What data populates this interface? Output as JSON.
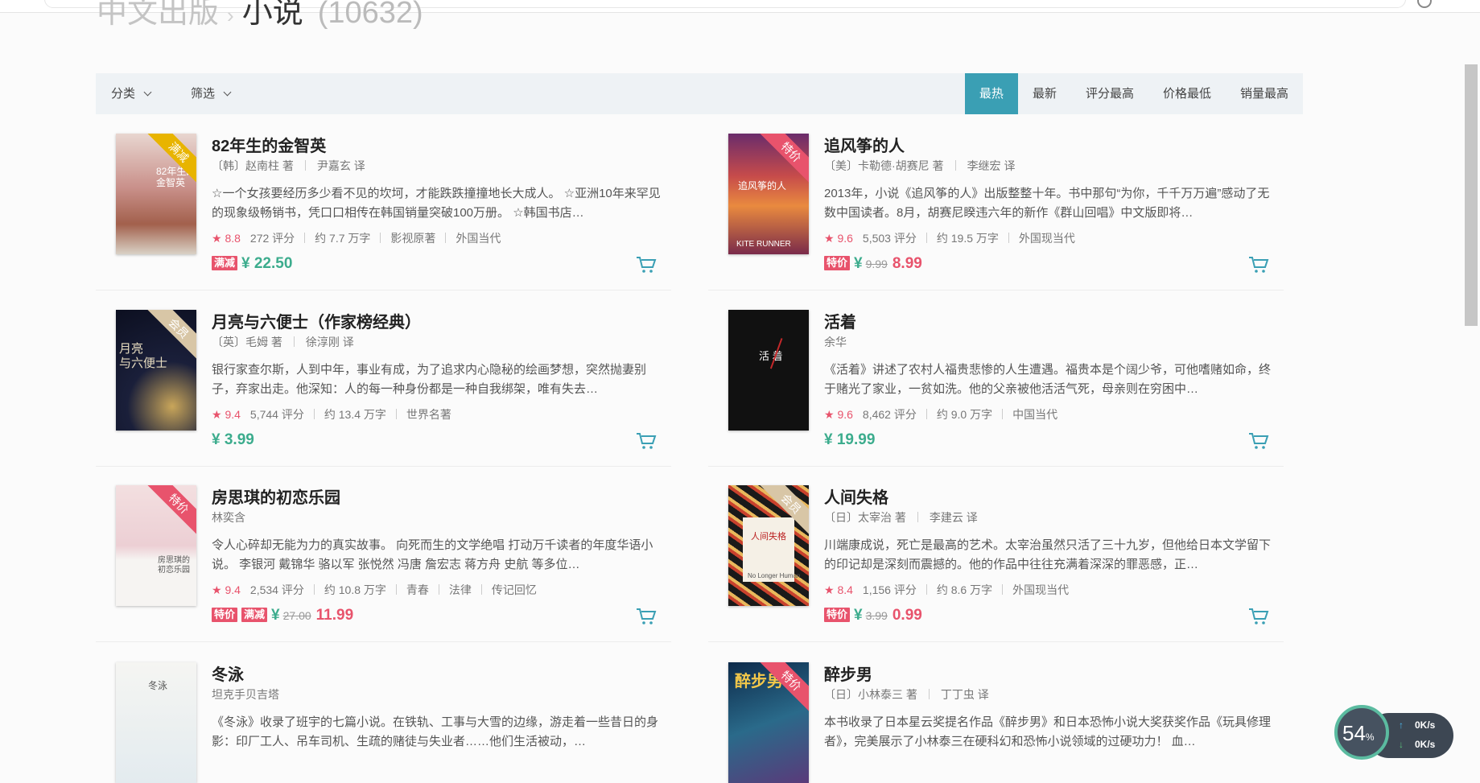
{
  "breadcrumb": {
    "category": "中文出版",
    "current": "小说",
    "count": "(10632)"
  },
  "filters": [
    {
      "label": "分类"
    },
    {
      "label": "筛选"
    }
  ],
  "sorts": [
    {
      "label": "最热",
      "active": true
    },
    {
      "label": "最新"
    },
    {
      "label": "评分最高"
    },
    {
      "label": "价格最低"
    },
    {
      "label": "销量最高"
    }
  ],
  "books": [
    {
      "title": "82年生的金智英",
      "authors": [
        "〔韩〕赵南柱 著",
        "尹嘉玄 译"
      ],
      "desc": "☆一个女孩要经历多少看不见的坎坷，才能跌跌撞撞地长大成人。 ☆亚洲10年来罕见的现象级畅销书，凭口口相传在韩国销量突破100万册。 ☆韩国书店…",
      "rating": "8.8",
      "reviews": "272 评分",
      "words": "约 7.7 万字",
      "tags": [
        "影视原著",
        "外国当代"
      ],
      "badges": [
        "满减"
      ],
      "price": "¥ 22.50",
      "ribbon": "满减",
      "cover_title": "82年生的\n金智英"
    },
    {
      "title": "追风筝的人",
      "authors": [
        "〔美〕卡勒德·胡赛尼 著",
        "李继宏 译"
      ],
      "desc": "2013年，小说《追风筝的人》出版整整十年。书中那句“为你，千千万万遍”感动了无数中国读者。8月，胡赛尼睽违六年的新作《群山回唱》中文版即将…",
      "rating": "9.6",
      "reviews": "5,503 评分",
      "words": "约 19.5 万字",
      "tags": [
        "外国现当代"
      ],
      "badges": [
        "特价"
      ],
      "old_price": "9.99",
      "new_price": "8.99",
      "ribbon": "特价",
      "cover_title": "追风筝的人",
      "cover_sub": "KITE RUNNER"
    },
    {
      "title": "月亮与六便士（作家榜经典）",
      "authors": [
        "〔英〕毛姆 著",
        "徐淳刚 译"
      ],
      "desc": "银行家查尔斯，人到中年，事业有成，为了追求内心隐秘的绘画梦想，突然抛妻别子，弃家出走。他深知：人的每一种身份都是一种自我绑架，唯有失去…",
      "rating": "9.4",
      "reviews": "5,744 评分",
      "words": "约 13.4 万字",
      "tags": [
        "世界名著"
      ],
      "badges": [],
      "price": "¥ 3.99",
      "ribbon": "会员",
      "cover_title": "月亮\n与六便士"
    },
    {
      "title": "活着",
      "authors": [
        "余华"
      ],
      "desc": "《活着》讲述了农村人福贵悲惨的人生遭遇。福贵本是个阔少爷，可他嗜赌如命，终于赌光了家业，一贫如洗。他的父亲被他活活气死，母亲则在穷困中…",
      "rating": "9.6",
      "reviews": "8,462 评分",
      "words": "约 9.0 万字",
      "tags": [
        "中国当代"
      ],
      "badges": [],
      "price": "¥ 19.99",
      "ribbon": "",
      "cover_title": "活 着"
    },
    {
      "title": "房思琪的初恋乐园",
      "authors": [
        "林奕含"
      ],
      "desc": "令人心碎却无能为力的真实故事。 向死而生的文学绝唱 打动万千读者的年度华语小说。 李银河 戴锦华 骆以军 张悦然 冯唐 詹宏志 蒋方舟 史航 等多位…",
      "rating": "9.4",
      "reviews": "2,534 评分",
      "words": "约 10.8 万字",
      "tags": [
        "青春",
        "法律",
        "传记回忆"
      ],
      "badges": [
        "特价",
        "满减"
      ],
      "old_price": "27.00",
      "new_price": "11.99",
      "ribbon": "特价",
      "cover_title": "房思琪的\n初恋乐园"
    },
    {
      "title": "人间失格",
      "authors": [
        "〔日〕太宰治 著",
        "李建云 译"
      ],
      "desc": "川端康成说，死亡是最高的艺术。太宰治虽然只活了三十九岁，但他给日本文学留下的印记却是深刻而震撼的。他的作品中往往充满着深深的罪恶感，正…",
      "rating": "8.4",
      "reviews": "1,156 评分",
      "words": "约 8.6 万字",
      "tags": [
        "外国现当代"
      ],
      "badges": [
        "特价"
      ],
      "old_price": "3.99",
      "new_price": "0.99",
      "ribbon": "会员",
      "cover_title": "人间失格",
      "cover_sub": "No Longer Human"
    },
    {
      "title": "冬泳",
      "authors": [
        "坦克手贝吉塔"
      ],
      "desc": "《冬泳》收录了班宇的七篇小说。在铁轨、工事与大雪的边缘，游走着一些昔日的身影：印厂工人、吊车司机、生疏的赌徒与失业者……他们生活被动，…",
      "ribbon": "",
      "cover_title": "冬泳"
    },
    {
      "title": "醉步男",
      "authors": [
        "〔日〕小林泰三 著",
        "丁丁虫 译"
      ],
      "desc": "本书收录了日本星云奖提名作品《醉步男》和日本恐怖小说大奖获奖作品《玩具修理者》，完美展示了小林泰三在硬科幻和恐怖小说领域的过硬功力！ 血…",
      "ribbon": "特价",
      "cover_title": "醉步男"
    }
  ],
  "widget": {
    "percent": "54",
    "percent_unit": "%",
    "up": "0K/s",
    "down": "0K/s"
  },
  "colors": {
    "accent": "#3a9fb4",
    "price_green": "#3cac8d",
    "sale_red": "#e8536c"
  },
  "icons": {
    "cart": "cart-icon",
    "dropdown": "chevron-down-icon",
    "star": "star-icon"
  }
}
